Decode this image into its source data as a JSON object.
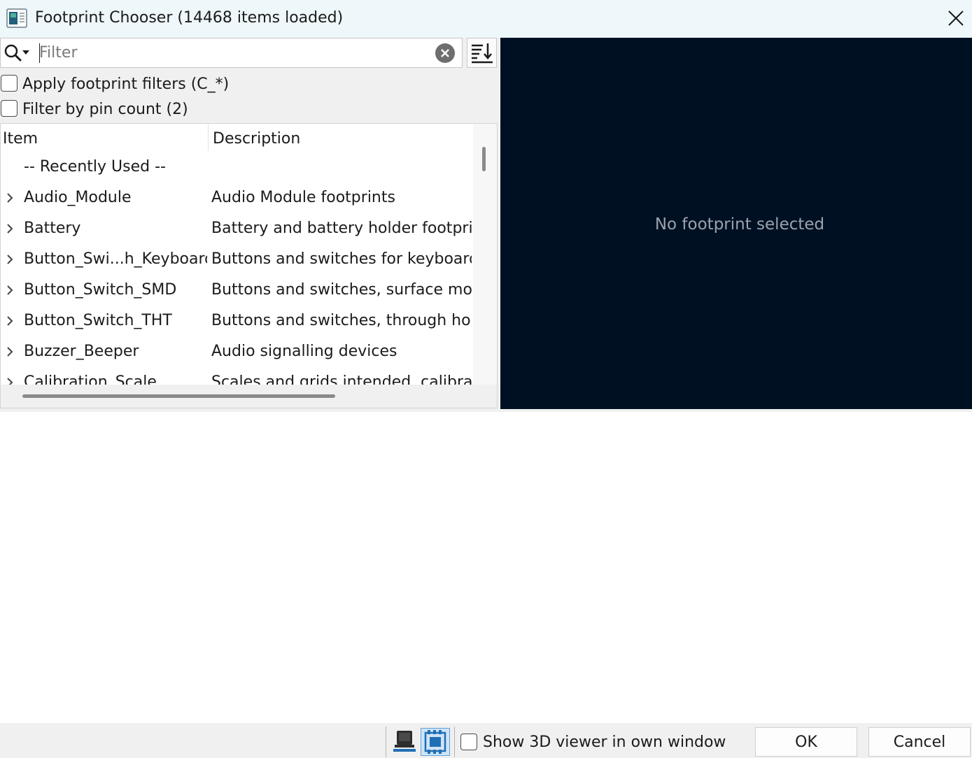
{
  "window": {
    "title": "Footprint Chooser (14468 items loaded)"
  },
  "search": {
    "placeholder": "Filter",
    "value": ""
  },
  "filters": {
    "apply_footprint_filters": {
      "label": "Apply footprint filters (C_*)",
      "checked": false
    },
    "filter_by_pin_count": {
      "label": "Filter by pin count (2)",
      "checked": false
    }
  },
  "tree": {
    "columns": {
      "item": "Item",
      "description": "Description"
    },
    "rows": [
      {
        "item": "-- Recently Used --",
        "description": "",
        "expandable": false
      },
      {
        "item": "Audio_Module",
        "description": "Audio Module footprints",
        "expandable": true
      },
      {
        "item": "Battery",
        "description": "Battery and battery holder footprints",
        "expandable": true
      },
      {
        "item": "Button_Swi...h_Keyboard",
        "description": "Buttons and switches for keyboard",
        "expandable": true
      },
      {
        "item": "Button_Switch_SMD",
        "description": "Buttons and switches, surface mount",
        "expandable": true
      },
      {
        "item": "Button_Switch_THT",
        "description": "Buttons and switches, through hole",
        "expandable": true
      },
      {
        "item": "Buzzer_Beeper",
        "description": "Audio signalling devices",
        "expandable": true
      },
      {
        "item": "Calibration_Scale",
        "description": "Scales and grids intended, calibration",
        "expandable": true
      }
    ]
  },
  "preview": {
    "empty_text": "No footprint selected",
    "background": "#001023"
  },
  "bottom": {
    "show_3d_label": "Show 3D viewer in own window",
    "show_3d_checked": false,
    "ok_label": "OK",
    "cancel_label": "Cancel",
    "icons": [
      "3d-viewer-icon",
      "footprint-viewer-icon"
    ]
  }
}
